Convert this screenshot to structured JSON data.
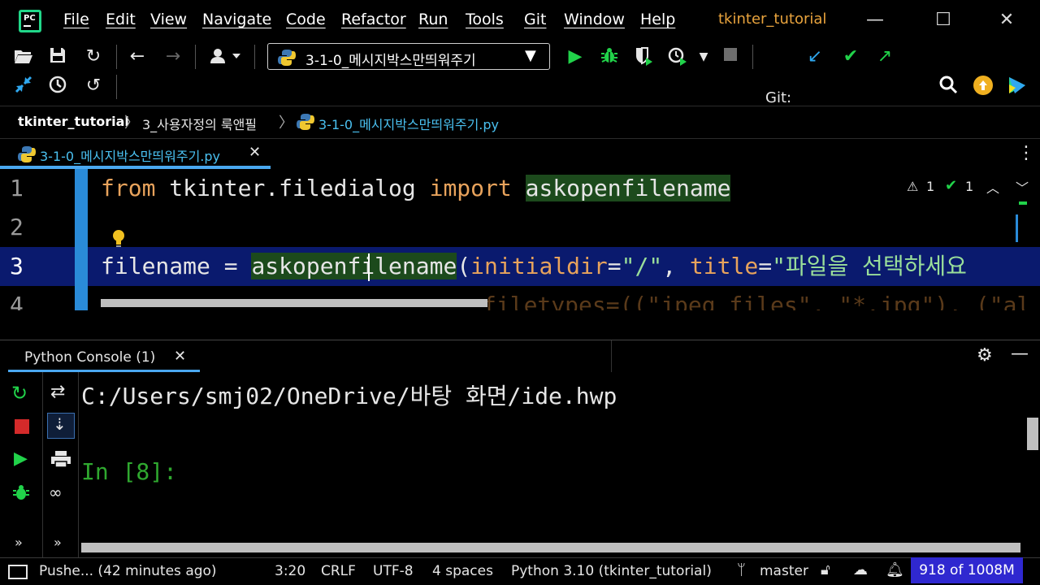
{
  "menu": {
    "items": [
      "File",
      "Edit",
      "View",
      "Navigate",
      "Code",
      "Refactor",
      "Run",
      "Tools",
      "Git",
      "Window",
      "Help"
    ],
    "project_title": "tkinter_tutorial"
  },
  "toolbar": {
    "run_config": "3-1-0_메시지박스만띄워주기",
    "git_label": "Git:"
  },
  "breadcrumb": [
    "tkinter_tutorial",
    "3_사용자정의 룩앤필",
    "3-1-0_메시지박스만띄워주기.py"
  ],
  "editor": {
    "tab_label": "3-1-0_메시지박스만띄워주기.py",
    "warnings_count": "1",
    "checks_count": "1",
    "line_numbers": [
      "1",
      "2",
      "3",
      "4"
    ],
    "line1": {
      "kw_from": "from",
      "module": " tkinter.filedialog ",
      "kw_import": "import",
      "name": "askopenfilename"
    },
    "line3": {
      "var": "filename = ",
      "fn": "askopenfilename",
      "open": "(",
      "p1": "initialdir",
      "eq1": "=",
      "s1": "\"/\"",
      "comma": ", ",
      "p2": "title",
      "eq2": "=",
      "s2": "\"파일을 선택하세요"
    },
    "line4_faded": "filetypes=((\"jpeg files\", \"*.jpg\"), (\"al"
  },
  "console": {
    "tab_label": "Python Console (1)",
    "output": "C:/Users/smj02/OneDrive/바탕 화면/ide.hwp",
    "prompt": "In [8]:"
  },
  "status": {
    "git_push": "Pushe... (42 minutes ago)",
    "position": "3:20",
    "line_sep": "CRLF",
    "encoding": "UTF-8",
    "indent": "4 spaces",
    "interpreter": "Python 3.10 (tkinter_tutorial)",
    "branch": "master",
    "memory": "918 of 1008M"
  },
  "colors": {
    "accent_blue": "#4aa8f0",
    "run_green": "#21d24a",
    "highlight_line": "#0a1a6e",
    "memory_bg": "#2f28d0"
  }
}
